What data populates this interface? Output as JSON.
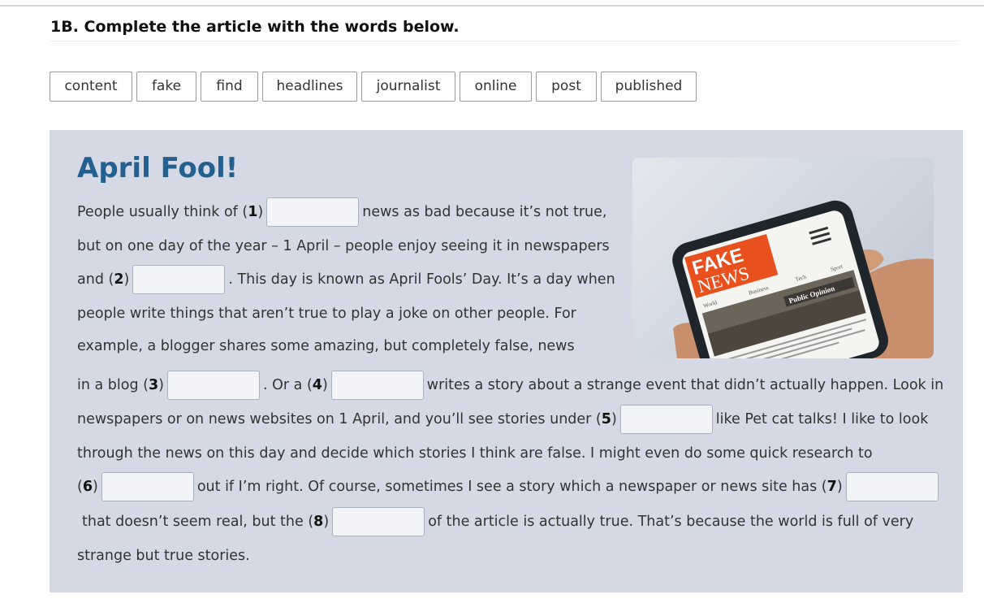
{
  "task": {
    "title": "1B. Complete the article with the words below."
  },
  "word_bank": [
    "content",
    "fake",
    "find",
    "headlines",
    "journalist",
    "online",
    "post",
    "published"
  ],
  "article": {
    "title": "April Fool!",
    "l1": {
      "a": "People usually think of (",
      "n": "1",
      "b": ")",
      "c": "news as bad because it’s not true,"
    },
    "l2": {
      "a": "but on one day of the year – 1 April – people enjoy seeing it in newspapers"
    },
    "l3": {
      "a": "and (",
      "n": "2",
      "b": ")",
      "c": ". This day is known as April Fools’ Day. It’s a day when"
    },
    "l4": {
      "a": "people write things that aren’t true to play a joke on other people. For"
    },
    "l5": {
      "a": "example, a blogger shares some amazing, but completely false, news"
    },
    "l6": {
      "a": "in a blog (",
      "n1": "3",
      "b": ")",
      "c": ". Or a (",
      "n2": "4",
      "d": ")",
      "e": "writes a story about a strange event that didn’t actually happen. Look in"
    },
    "l7": {
      "a": "newspapers or on news websites on 1 April, and you’ll see stories under (",
      "n": "5",
      "b": ")",
      "c": "like Pet cat talks! I like to look"
    },
    "l8": {
      "a": "through the news on this day and decide which stories I think are false. I might even do some quick research to"
    },
    "l9": {
      "a": "(",
      "n1": "6",
      "b": ")",
      "c": "out if I’m right. Of course, sometimes I see a story which a newspaper or news site has (",
      "n2": "7",
      "d": ")"
    },
    "l10": {
      "a": "that doesn’t seem real, but the (",
      "n": "8",
      "b": ")",
      "c": "of the article is actually true. That’s because the world is full of very"
    },
    "l11": {
      "a": "strange but true stories."
    }
  },
  "image": {
    "badge_line1": "FAKE",
    "badge_line2": "NEWS",
    "nav": [
      "World",
      "Business",
      "Tech",
      "Sport"
    ],
    "caption": "Public Opinion"
  },
  "colors": {
    "panel": "#d5d9e6",
    "heading": "#24608f",
    "badge": "#e8501e"
  }
}
